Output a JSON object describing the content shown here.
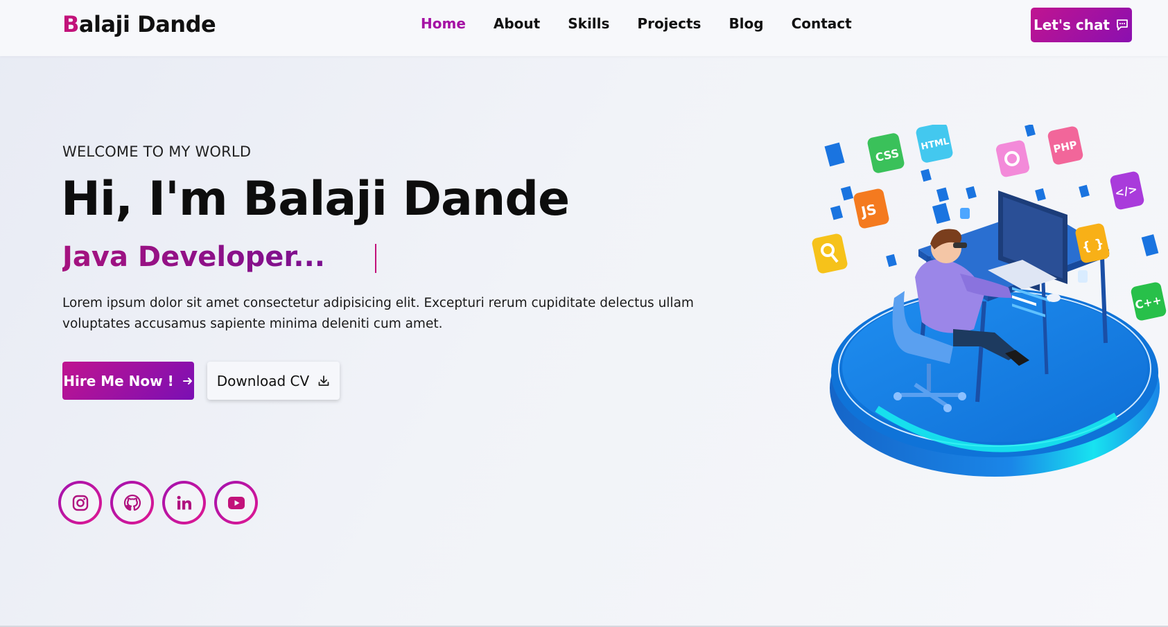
{
  "navbar": {
    "brand_first": "B",
    "brand_rest": "alaji Dande",
    "links": [
      {
        "label": "Home",
        "active": true
      },
      {
        "label": "About",
        "active": false
      },
      {
        "label": "Skills",
        "active": false
      },
      {
        "label": "Projects",
        "active": false
      },
      {
        "label": "Blog",
        "active": false
      },
      {
        "label": "Contact",
        "active": false
      }
    ],
    "chat_label": "Let's chat"
  },
  "hero": {
    "welcome": "WELCOME TO MY WORLD",
    "headline": "Hi, I'm Balaji Dande",
    "role": "Java Developer...",
    "description": "Lorem ipsum dolor sit amet consectetur adipisicing elit. Excepturi rerum cupiditate delectus ullam voluptates accusamus sapiente minima deleniti cum amet.",
    "hire_label": "Hire Me Now !",
    "cv_label": "Download CV"
  },
  "socials": [
    {
      "icon": "instagram-icon"
    },
    {
      "icon": "github-icon"
    },
    {
      "icon": "linkedin-icon"
    },
    {
      "icon": "youtube-icon"
    }
  ],
  "illustration": {
    "tiles": [
      "CSS",
      "HTML",
      "PHP",
      "JS",
      "{ }",
      "C++",
      "</>"
    ]
  },
  "colors": {
    "accent": "#c2127a",
    "accent_purple": "#8a0fb0",
    "platform": "#1a8fe6",
    "glow": "#19e9f2"
  }
}
